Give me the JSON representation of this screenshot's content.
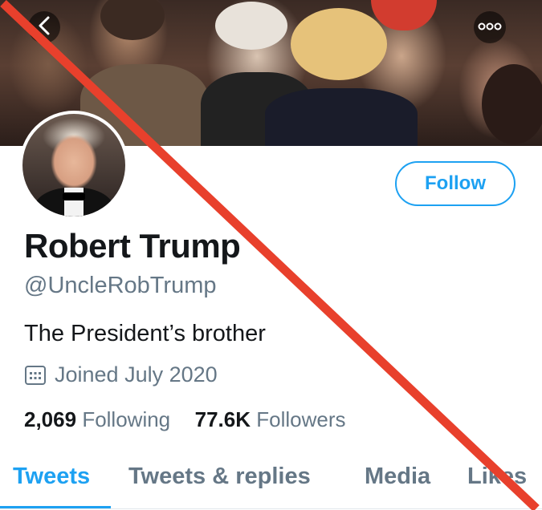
{
  "header": {
    "back_icon": "chevron-left-icon",
    "more_icon": "more-dots-icon"
  },
  "profile": {
    "name": "Robert Trump",
    "handle": "@UncleRobTrump",
    "bio": "The President’s brother",
    "joined": "Joined July 2020",
    "joined_icon": "calendar-icon",
    "follow_label": "Follow"
  },
  "stats": {
    "following_count": "2,069",
    "following_label": "Following",
    "followers_count": "77.6K",
    "followers_label": "Followers"
  },
  "tabs": [
    {
      "label": "Tweets",
      "active": true
    },
    {
      "label": "Tweets & replies",
      "active": false
    },
    {
      "label": "Media",
      "active": false
    },
    {
      "label": "Likes",
      "active": false
    }
  ],
  "colors": {
    "accent": "#1da1f2",
    "text_primary": "#14171a",
    "text_secondary": "#657786",
    "strike_line": "#e8402c"
  }
}
